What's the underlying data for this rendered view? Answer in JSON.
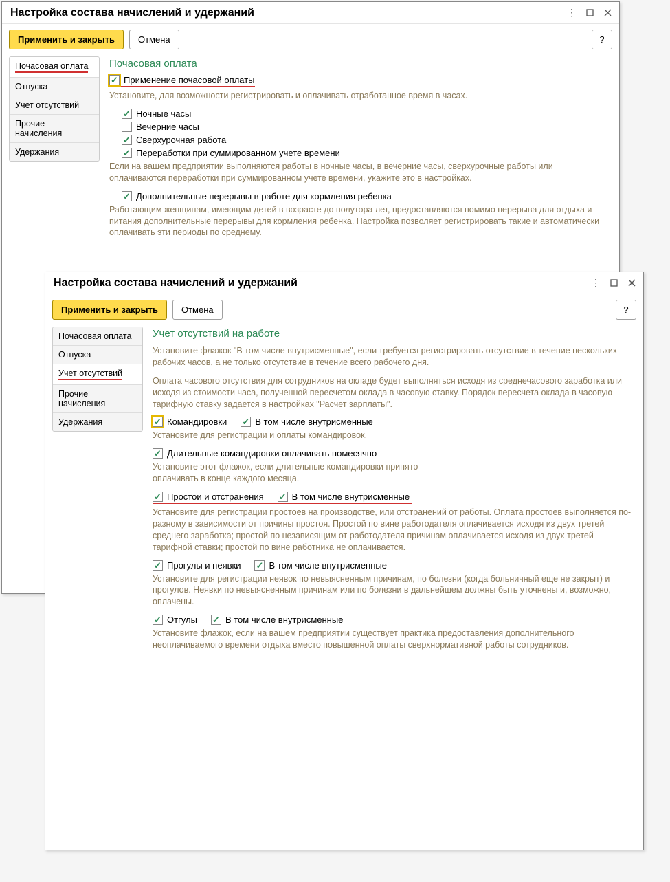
{
  "window_title": "Настройка состава начислений и удержаний",
  "buttons": {
    "apply_close": "Применить и закрыть",
    "cancel": "Отмена",
    "help": "?"
  },
  "nav": [
    "Почасовая оплата",
    "Отпуска",
    "Учет отсутствий",
    "Прочие начисления",
    "Удержания"
  ],
  "win1": {
    "section_title": "Почасовая оплата",
    "chk_hourly_pay": "Применение почасовой оплаты",
    "help_hourly": "Установите, для возможности регистрировать и оплачивать отработанное время в часах.",
    "chk_night": "Ночные часы",
    "chk_evening": "Вечерние часы",
    "chk_overtime": "Сверхурочная работа",
    "chk_recycle": "Переработки при суммированном учете времени",
    "help_night": "Если на вашем предприятии выполняются работы в ночные часы, в вечерние часы, сверхурочные работы или оплачиваются переработки при суммированном учете времени, укажите это в настройках.",
    "chk_breaks": "Дополнительные перерывы в работе для кормления ребенка",
    "help_breaks": "Работающим женщинам, имеющим детей в возрасте до полутора лет, предоставляются помимо перерыва для отдыха и питания дополнительные перерывы для кормления ребенка. Настройка позволяет регистрировать такие и автоматически оплачивать эти периоды по среднему."
  },
  "win2": {
    "section_title": "Учет отсутствий на работе",
    "help_intro": "Установите флажок \"В том числе внутрисменные\", если требуется регистрировать отсутствие в течение нескольких рабочих часов, а не только отсутствие в течение всего рабочего дня.",
    "help_salary": "Оплата часового отсутствия для сотрудников на окладе будет выполняться исходя из среднечасового заработка или исходя из стоимости часа, полученной пересчетом оклада в часовую ставку. Порядок пересчета оклада в часовую тарифную ставку задается в настройках \"Расчет зарплаты\".",
    "chk_trips": "Командировки",
    "chk_trips_intr": "В том числе внутрисменные",
    "help_trips": "Установите для регистрации и оплаты командировок.",
    "chk_long_trips": "Длительные командировки оплачивать помесячно",
    "help_long_trips": "Установите этот флажок, если длительные командировки принято оплачивать в конце каждого месяца.",
    "chk_idle": "Простои и отстранения",
    "chk_idle_intr": "В том числе внутрисменные",
    "help_idle": "Установите для регистрации простоев на производстве, или отстранений от работы. Оплата простоев выполняется по-разному в зависимости от причины простоя. Простой по вине работодателя оплачивается исходя из двух третей среднего заработка; простой по независящим от работодателя причинам оплачивается исходя из двух третей тарифной ставки; простой по вине работника не оплачивается.",
    "chk_absent": "Прогулы и неявки",
    "chk_absent_intr": "В том числе внутрисменные",
    "help_absent": "Установите для регистрации неявок по невыясненным причинам, по болезни (когда больничный еще не закрыт) и прогулов. Неявки по невыясненным причинам или по болезни в дальнейшем должны быть уточнены и, возможно, оплачены.",
    "chk_dayoff": "Отгулы",
    "chk_dayoff_intr": "В том числе внутрисменные",
    "help_dayoff": "Установите флажок, если на вашем предприятии существует практика предоставления дополнительного неоплачиваемого времени отдыха вместо повышенной оплаты сверхнормативной работы сотрудников."
  }
}
